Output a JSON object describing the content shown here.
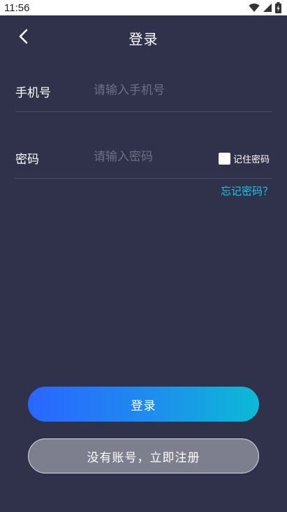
{
  "status_bar": {
    "time": "11:56",
    "icons": [
      "wifi-icon",
      "signal-icon",
      "battery-charging-icon"
    ]
  },
  "header": {
    "title": "登录",
    "back_icon": "chevron-left-icon"
  },
  "form": {
    "phone": {
      "label": "手机号",
      "placeholder": "请输入手机号",
      "value": ""
    },
    "password": {
      "label": "密码",
      "placeholder": "请输入密码",
      "value": ""
    },
    "remember_label": "记住密码",
    "remember_checked": false,
    "forgot_label": "忘记密码？"
  },
  "actions": {
    "login_label": "登录",
    "register_label": "没有账号，立即注册"
  },
  "colors": {
    "background": "#30324b",
    "accent_link": "#19c8e8",
    "gradient_start": "#2a66ff",
    "gradient_end": "#0bbad6",
    "secondary_button": "#7d7f8f"
  }
}
